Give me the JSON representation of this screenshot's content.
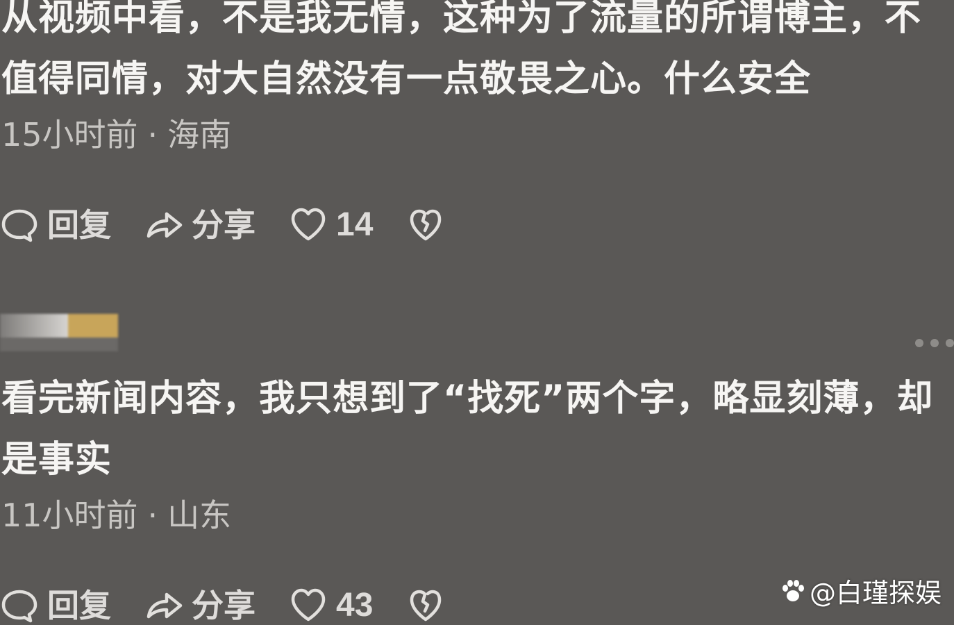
{
  "comments": [
    {
      "text": "从视频中看，不是我无情，这种为了流量的所谓博主，不值得同情，对大自然没有一点敬畏之心。什么安全",
      "time": "15小时前",
      "location": "海南",
      "reply_label": "回复",
      "share_label": "分享",
      "like_count": "14"
    },
    {
      "text": "看完新闻内容，我只想到了“找死”两个字，略显刻薄，却是事实",
      "time": "11小时前",
      "location": "山东",
      "reply_label": "回复",
      "share_label": "分享",
      "like_count": "43"
    }
  ],
  "meta_separator": "·",
  "watermark": "@白瑾探娱",
  "icons": {
    "reply": "comment-bubble-icon",
    "share": "share-arrow-icon",
    "like": "heart-icon",
    "dislike": "broken-heart-icon",
    "more": "more-dots-icon",
    "watermark": "paw-icon"
  },
  "colors": {
    "background": "#5a5856",
    "text": "#f6f5f3",
    "meta": "#c8c6c3",
    "username_accent": "#c8a55a"
  }
}
